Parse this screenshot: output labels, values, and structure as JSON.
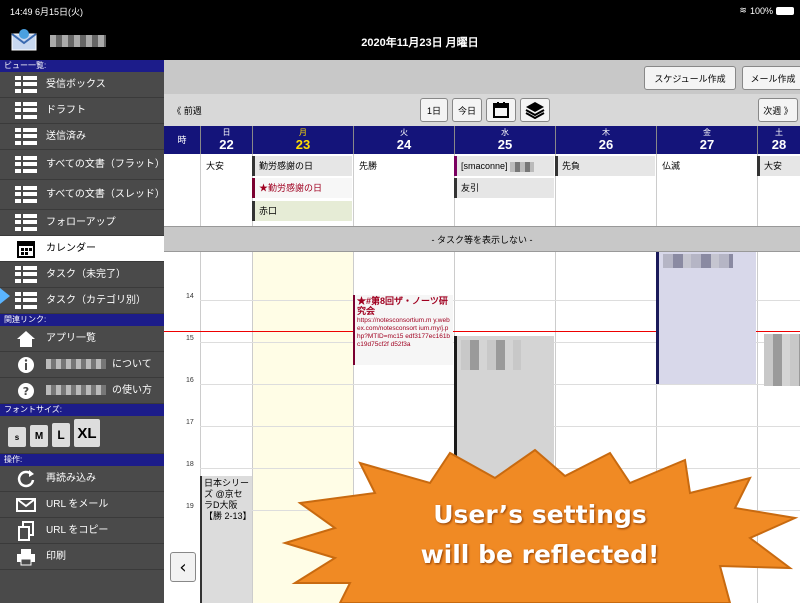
{
  "status_bar": {
    "time": "14:49  6月15日(火)",
    "battery": "100%"
  },
  "header": {
    "title": "2020年11月23日 月曜日",
    "mail_icon": "mail-icon"
  },
  "sidebar": {
    "view_section": "ビュー一覧:",
    "view_items": [
      {
        "label": "受信ボックス",
        "icon": "list-icon"
      },
      {
        "label": "ドラフト",
        "icon": "list-icon"
      },
      {
        "label": "送信済み",
        "icon": "list-icon"
      },
      {
        "label": "すべての文書（フラット）",
        "icon": "list-icon"
      },
      {
        "label": "すべての文書（スレッド）",
        "icon": "list-icon"
      },
      {
        "label": "フォローアップ",
        "icon": "list-icon"
      },
      {
        "label": "カレンダー",
        "icon": "calendar-icon"
      },
      {
        "label": "タスク（未完了）",
        "icon": "list-icon"
      },
      {
        "label": "タスク（カテゴリ別）",
        "icon": "list-icon"
      }
    ],
    "links_section": "関連リンク:",
    "link_items": [
      {
        "label": "アプリ一覧",
        "icon": "home-icon"
      },
      {
        "label": "について",
        "icon": "info-icon"
      },
      {
        "label": "の使い方",
        "icon": "help-icon"
      }
    ],
    "font_section": "フォントサイズ:",
    "font_sizes": [
      "s",
      "M",
      "L",
      "XL"
    ],
    "ops_section": "操作:",
    "op_items": [
      {
        "label": "再読み込み",
        "icon": "reload-icon"
      },
      {
        "label": "URL をメール",
        "icon": "email-icon"
      },
      {
        "label": "URL をコピー",
        "icon": "copy-icon"
      },
      {
        "label": "印刷",
        "icon": "print-icon"
      }
    ]
  },
  "toolbar": {
    "create_schedule": "スケジュール作成",
    "create_mail": "メール作成",
    "prev_week": "《 前週",
    "next_week": "次週 》",
    "day_view": "1日",
    "today": "今日"
  },
  "calendar": {
    "time_header": "時",
    "days": [
      {
        "weekday": "日",
        "day": "22"
      },
      {
        "weekday": "月",
        "day": "23"
      },
      {
        "weekday": "火",
        "day": "24"
      },
      {
        "weekday": "水",
        "day": "25"
      },
      {
        "weekday": "木",
        "day": "26"
      },
      {
        "weekday": "金",
        "day": "27"
      },
      {
        "weekday": "土",
        "day": "28"
      }
    ],
    "allday": {
      "sun_rokuyo": "大安",
      "mon_row1": "勤労感謝の日",
      "mon_row2": "★勤労感謝の日",
      "mon_row3": "赤口",
      "tue_rokuyo": "先勝",
      "wed_row1": "[smaconne]",
      "wed_row2": "友引",
      "thu_rokuyo": "先負",
      "fri_rokuyo": "仏滅",
      "sat_rokuyo": "大安"
    },
    "no_task_banner": "- タスク等を表示しない -",
    "hours": [
      "14",
      "15",
      "16",
      "17",
      "18",
      "19"
    ],
    "events": {
      "tue_title": "★#第8回ザ・ノーツ研究会",
      "tue_url": "https://notesconsortium.m y.webex.com/notesconsort ium.my/j.php?MTID=mc15 edf3177ec161bc19d75cf2f d52f3a",
      "sun_title": "日本シリーズ @京セラD大阪【勝 2-13】"
    }
  },
  "promo": {
    "line1": "User’s settings",
    "line2": "will be reflected!"
  }
}
